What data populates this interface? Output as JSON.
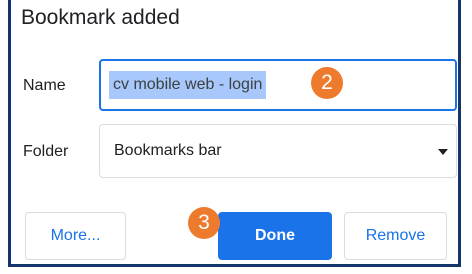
{
  "dialog": {
    "title": "Bookmark added",
    "name": {
      "label": "Name",
      "value": "cv mobile web - login"
    },
    "folder": {
      "label": "Folder",
      "selected": "Bookmarks bar",
      "icon": "caret-down-icon"
    },
    "buttons": {
      "more": "More...",
      "done": "Done",
      "remove": "Remove"
    }
  },
  "callouts": {
    "name_step": "2",
    "done_step": "3"
  },
  "colors": {
    "accent": "#1a73e8",
    "selection": "#a8c7fa",
    "callout": "#ee7a2e",
    "frame_border": "#14356b"
  }
}
